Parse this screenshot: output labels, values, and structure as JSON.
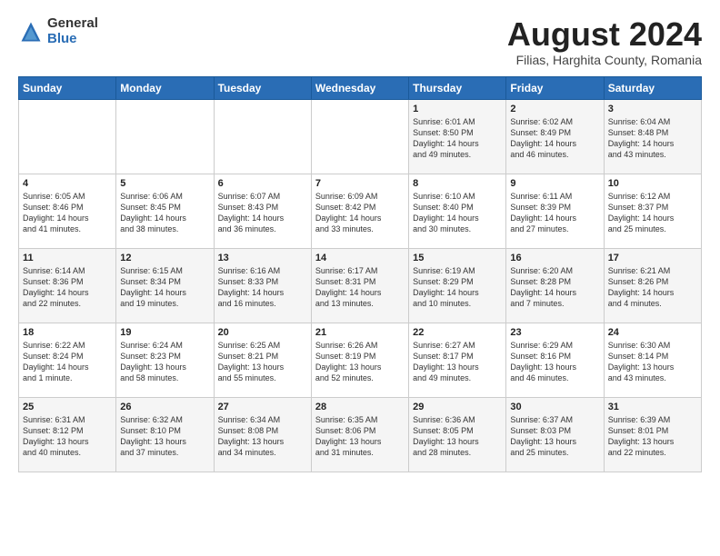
{
  "logo": {
    "general": "General",
    "blue": "Blue"
  },
  "title": "August 2024",
  "location": "Filias, Harghita County, Romania",
  "headers": [
    "Sunday",
    "Monday",
    "Tuesday",
    "Wednesday",
    "Thursday",
    "Friday",
    "Saturday"
  ],
  "weeks": [
    [
      {
        "day": "",
        "info": ""
      },
      {
        "day": "",
        "info": ""
      },
      {
        "day": "",
        "info": ""
      },
      {
        "day": "",
        "info": ""
      },
      {
        "day": "1",
        "info": "Sunrise: 6:01 AM\nSunset: 8:50 PM\nDaylight: 14 hours\nand 49 minutes."
      },
      {
        "day": "2",
        "info": "Sunrise: 6:02 AM\nSunset: 8:49 PM\nDaylight: 14 hours\nand 46 minutes."
      },
      {
        "day": "3",
        "info": "Sunrise: 6:04 AM\nSunset: 8:48 PM\nDaylight: 14 hours\nand 43 minutes."
      }
    ],
    [
      {
        "day": "4",
        "info": "Sunrise: 6:05 AM\nSunset: 8:46 PM\nDaylight: 14 hours\nand 41 minutes."
      },
      {
        "day": "5",
        "info": "Sunrise: 6:06 AM\nSunset: 8:45 PM\nDaylight: 14 hours\nand 38 minutes."
      },
      {
        "day": "6",
        "info": "Sunrise: 6:07 AM\nSunset: 8:43 PM\nDaylight: 14 hours\nand 36 minutes."
      },
      {
        "day": "7",
        "info": "Sunrise: 6:09 AM\nSunset: 8:42 PM\nDaylight: 14 hours\nand 33 minutes."
      },
      {
        "day": "8",
        "info": "Sunrise: 6:10 AM\nSunset: 8:40 PM\nDaylight: 14 hours\nand 30 minutes."
      },
      {
        "day": "9",
        "info": "Sunrise: 6:11 AM\nSunset: 8:39 PM\nDaylight: 14 hours\nand 27 minutes."
      },
      {
        "day": "10",
        "info": "Sunrise: 6:12 AM\nSunset: 8:37 PM\nDaylight: 14 hours\nand 25 minutes."
      }
    ],
    [
      {
        "day": "11",
        "info": "Sunrise: 6:14 AM\nSunset: 8:36 PM\nDaylight: 14 hours\nand 22 minutes."
      },
      {
        "day": "12",
        "info": "Sunrise: 6:15 AM\nSunset: 8:34 PM\nDaylight: 14 hours\nand 19 minutes."
      },
      {
        "day": "13",
        "info": "Sunrise: 6:16 AM\nSunset: 8:33 PM\nDaylight: 14 hours\nand 16 minutes."
      },
      {
        "day": "14",
        "info": "Sunrise: 6:17 AM\nSunset: 8:31 PM\nDaylight: 14 hours\nand 13 minutes."
      },
      {
        "day": "15",
        "info": "Sunrise: 6:19 AM\nSunset: 8:29 PM\nDaylight: 14 hours\nand 10 minutes."
      },
      {
        "day": "16",
        "info": "Sunrise: 6:20 AM\nSunset: 8:28 PM\nDaylight: 14 hours\nand 7 minutes."
      },
      {
        "day": "17",
        "info": "Sunrise: 6:21 AM\nSunset: 8:26 PM\nDaylight: 14 hours\nand 4 minutes."
      }
    ],
    [
      {
        "day": "18",
        "info": "Sunrise: 6:22 AM\nSunset: 8:24 PM\nDaylight: 14 hours\nand 1 minute."
      },
      {
        "day": "19",
        "info": "Sunrise: 6:24 AM\nSunset: 8:23 PM\nDaylight: 13 hours\nand 58 minutes."
      },
      {
        "day": "20",
        "info": "Sunrise: 6:25 AM\nSunset: 8:21 PM\nDaylight: 13 hours\nand 55 minutes."
      },
      {
        "day": "21",
        "info": "Sunrise: 6:26 AM\nSunset: 8:19 PM\nDaylight: 13 hours\nand 52 minutes."
      },
      {
        "day": "22",
        "info": "Sunrise: 6:27 AM\nSunset: 8:17 PM\nDaylight: 13 hours\nand 49 minutes."
      },
      {
        "day": "23",
        "info": "Sunrise: 6:29 AM\nSunset: 8:16 PM\nDaylight: 13 hours\nand 46 minutes."
      },
      {
        "day": "24",
        "info": "Sunrise: 6:30 AM\nSunset: 8:14 PM\nDaylight: 13 hours\nand 43 minutes."
      }
    ],
    [
      {
        "day": "25",
        "info": "Sunrise: 6:31 AM\nSunset: 8:12 PM\nDaylight: 13 hours\nand 40 minutes."
      },
      {
        "day": "26",
        "info": "Sunrise: 6:32 AM\nSunset: 8:10 PM\nDaylight: 13 hours\nand 37 minutes."
      },
      {
        "day": "27",
        "info": "Sunrise: 6:34 AM\nSunset: 8:08 PM\nDaylight: 13 hours\nand 34 minutes."
      },
      {
        "day": "28",
        "info": "Sunrise: 6:35 AM\nSunset: 8:06 PM\nDaylight: 13 hours\nand 31 minutes."
      },
      {
        "day": "29",
        "info": "Sunrise: 6:36 AM\nSunset: 8:05 PM\nDaylight: 13 hours\nand 28 minutes."
      },
      {
        "day": "30",
        "info": "Sunrise: 6:37 AM\nSunset: 8:03 PM\nDaylight: 13 hours\nand 25 minutes."
      },
      {
        "day": "31",
        "info": "Sunrise: 6:39 AM\nSunset: 8:01 PM\nDaylight: 13 hours\nand 22 minutes."
      }
    ]
  ]
}
